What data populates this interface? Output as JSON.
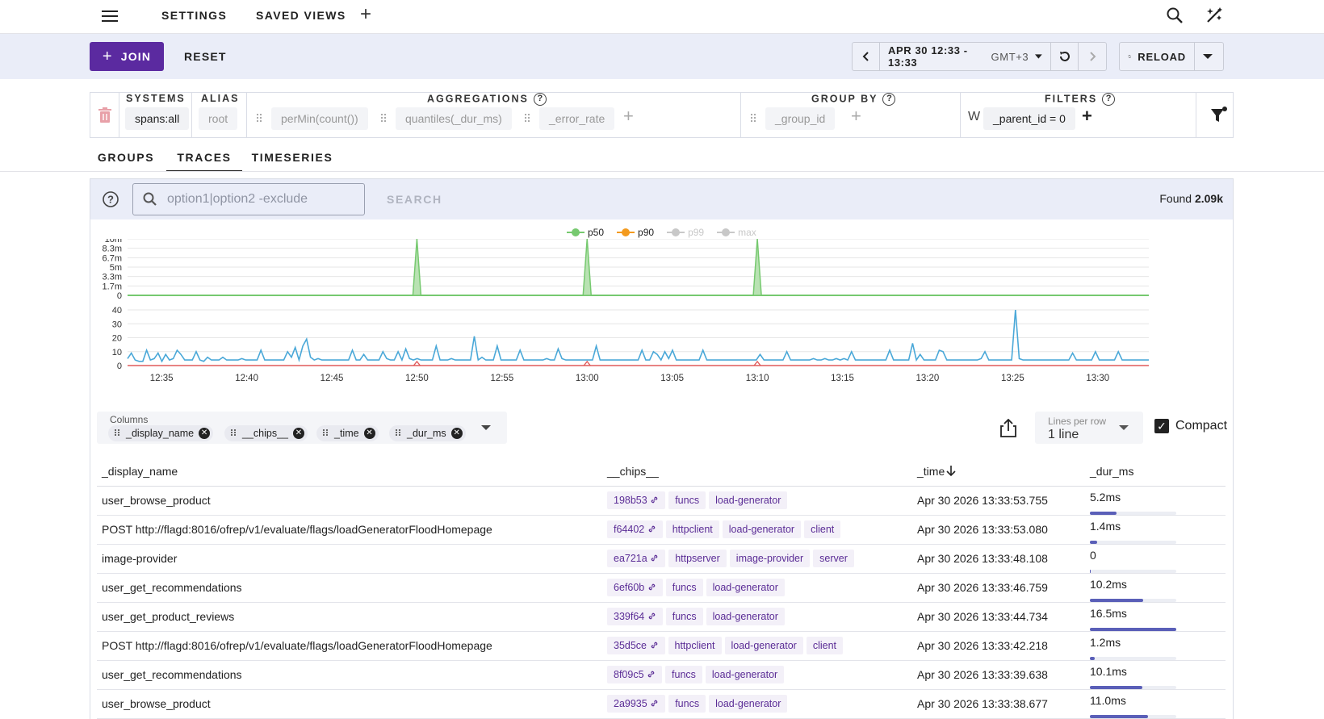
{
  "nav": {
    "settings": "SETTINGS",
    "saved_views": "SAVED VIEWS"
  },
  "actions": {
    "join": "JOIN",
    "reset": "RESET"
  },
  "time": {
    "range": "APR 30 12:33 - 13:33",
    "tz": "GMT+3",
    "reload": "RELOAD"
  },
  "query": {
    "systems_header": "SYSTEMS",
    "systems_value": "spans:all",
    "alias_header": "ALIAS",
    "alias_value": "root",
    "aggregations_header": "AGGREGATIONS",
    "aggregations": [
      "perMin(count())",
      "quantiles(_dur_ms)",
      "_error_rate"
    ],
    "groupby_header": "GROUP BY",
    "groupby": [
      "_group_id"
    ],
    "filters_header": "FILTERS",
    "filter_prefix": "W",
    "filter_value": "_parent_id = 0"
  },
  "tabs": [
    "GROUPS",
    "TRACES",
    "TIMESERIES"
  ],
  "search": {
    "placeholder": "option1|option2 -exclude",
    "button": "SEARCH",
    "found_label": "Found",
    "found_count": "2.09k"
  },
  "chart_data": {
    "type": "line",
    "legend": [
      "p50",
      "p90",
      "p99",
      "max"
    ],
    "legend_colors": [
      "#76c96f",
      "#f39a1e",
      "#c8c8c8",
      "#c8c8c8"
    ],
    "x_ticks": [
      "12:35",
      "12:40",
      "12:45",
      "12:50",
      "12:55",
      "13:00",
      "13:05",
      "13:10",
      "13:15",
      "13:20",
      "13:25",
      "13:30"
    ],
    "top_panel": {
      "y_ticks": [
        "10m",
        "8.3m",
        "6.7m",
        "5m",
        "3.3m",
        "1.7m",
        "0"
      ],
      "spikes_at": [
        "12:50",
        "13:00",
        "13:10"
      ],
      "spike_value": "10m"
    },
    "bottom_panel": {
      "y_ticks": [
        "40",
        "30",
        "20",
        "10",
        "0"
      ],
      "series_color": "#4aa8d8",
      "values": [
        5,
        9,
        4,
        3,
        3,
        11,
        4,
        5,
        9,
        3,
        8,
        4,
        5,
        11,
        8,
        4,
        4,
        4,
        10,
        4,
        3,
        6,
        4,
        4,
        4,
        6,
        4,
        4,
        4,
        4,
        5,
        4,
        4,
        4,
        4,
        11,
        4,
        4,
        4,
        4,
        4,
        4,
        10,
        6,
        13,
        4,
        14,
        19,
        6,
        4,
        5,
        4,
        4,
        4,
        4,
        4,
        4,
        4,
        4,
        11,
        4,
        4,
        8,
        4,
        4,
        4,
        4,
        10,
        5,
        4,
        4,
        10,
        4,
        12,
        5,
        4,
        5,
        4,
        4,
        4,
        4,
        14,
        4,
        4,
        4,
        5,
        4,
        4,
        4,
        4,
        4,
        21,
        4,
        6,
        4,
        4,
        4,
        14,
        4,
        4,
        4,
        4,
        4,
        11,
        4,
        4,
        4,
        4,
        4,
        4,
        5,
        4,
        4,
        12,
        5,
        4,
        4,
        4,
        4,
        4,
        4,
        4,
        4,
        14,
        4,
        4,
        4,
        4,
        4,
        4,
        4,
        4,
        4,
        4,
        4,
        11,
        4,
        4,
        10,
        8,
        4,
        10,
        5,
        11,
        4,
        4,
        4,
        4,
        4,
        4,
        4,
        11,
        4,
        4,
        4,
        4,
        4,
        4,
        4,
        4,
        4,
        4,
        4,
        4,
        4,
        4,
        8,
        4,
        4,
        4,
        4,
        4,
        4,
        10,
        4,
        4,
        4,
        4,
        4,
        4,
        5,
        4,
        4,
        5,
        4,
        4,
        5,
        4,
        5,
        4,
        10,
        4,
        4,
        4,
        4,
        4,
        4,
        4,
        4,
        4,
        11,
        4,
        4,
        4,
        4,
        4,
        16,
        4,
        8,
        4,
        4,
        4,
        4,
        11,
        10,
        4,
        4,
        4,
        4,
        4,
        4,
        4,
        4,
        4,
        5,
        10,
        4,
        4,
        4,
        4,
        4,
        4,
        4,
        40,
        5,
        4,
        4,
        4,
        4,
        4,
        4,
        4,
        4,
        4,
        4,
        4,
        4,
        4,
        9,
        4,
        4,
        4,
        4,
        4,
        10,
        4,
        4,
        4,
        4,
        4,
        10,
        4,
        4,
        4,
        4,
        4,
        4,
        4,
        4
      ]
    }
  },
  "columns": {
    "label": "Columns",
    "chips": [
      "_display_name",
      "__chips__",
      "_time",
      "_dur_ms"
    ]
  },
  "lines_per_row": {
    "label": "Lines per row",
    "value": "1 line"
  },
  "compact": {
    "label": "Compact",
    "checked": true
  },
  "table": {
    "headers": [
      "_display_name",
      "__chips__",
      "_time",
      "_dur_ms"
    ],
    "rows": [
      {
        "name": "user_browse_product",
        "hash": "198b53",
        "chips": [
          "funcs",
          "load-generator"
        ],
        "time": "Apr 30 2026 13:33:53.755",
        "dur": "5.2ms",
        "dur_frac": 0.31
      },
      {
        "name": "POST http://flagd:8016/ofrep/v1/evaluate/flags/loadGeneratorFloodHomepage",
        "hash": "f64402",
        "chips": [
          "httpclient",
          "load-generator",
          "client"
        ],
        "time": "Apr 30 2026 13:33:53.080",
        "dur": "1.4ms",
        "dur_frac": 0.08
      },
      {
        "name": "image-provider",
        "hash": "ea721a",
        "chips": [
          "httpserver",
          "image-provider",
          "server"
        ],
        "time": "Apr 30 2026 13:33:48.108",
        "dur": "0",
        "dur_frac": 0.0
      },
      {
        "name": "user_get_recommendations",
        "hash": "6ef60b",
        "chips": [
          "funcs",
          "load-generator"
        ],
        "time": "Apr 30 2026 13:33:46.759",
        "dur": "10.2ms",
        "dur_frac": 0.62
      },
      {
        "name": "user_get_product_reviews",
        "hash": "339f64",
        "chips": [
          "funcs",
          "load-generator"
        ],
        "time": "Apr 30 2026 13:33:44.734",
        "dur": "16.5ms",
        "dur_frac": 1.0
      },
      {
        "name": "POST http://flagd:8016/ofrep/v1/evaluate/flags/loadGeneratorFloodHomepage",
        "hash": "35d5ce",
        "chips": [
          "httpclient",
          "load-generator",
          "client"
        ],
        "time": "Apr 30 2026 13:33:42.218",
        "dur": "1.2ms",
        "dur_frac": 0.06
      },
      {
        "name": "user_get_recommendations",
        "hash": "8f09c5",
        "chips": [
          "funcs",
          "load-generator"
        ],
        "time": "Apr 30 2026 13:33:39.638",
        "dur": "10.1ms",
        "dur_frac": 0.61
      },
      {
        "name": "user_browse_product",
        "hash": "2a9935",
        "chips": [
          "funcs",
          "load-generator"
        ],
        "time": "Apr 30 2026 13:33:38.677",
        "dur": "11.0ms",
        "dur_frac": 0.67
      }
    ]
  }
}
